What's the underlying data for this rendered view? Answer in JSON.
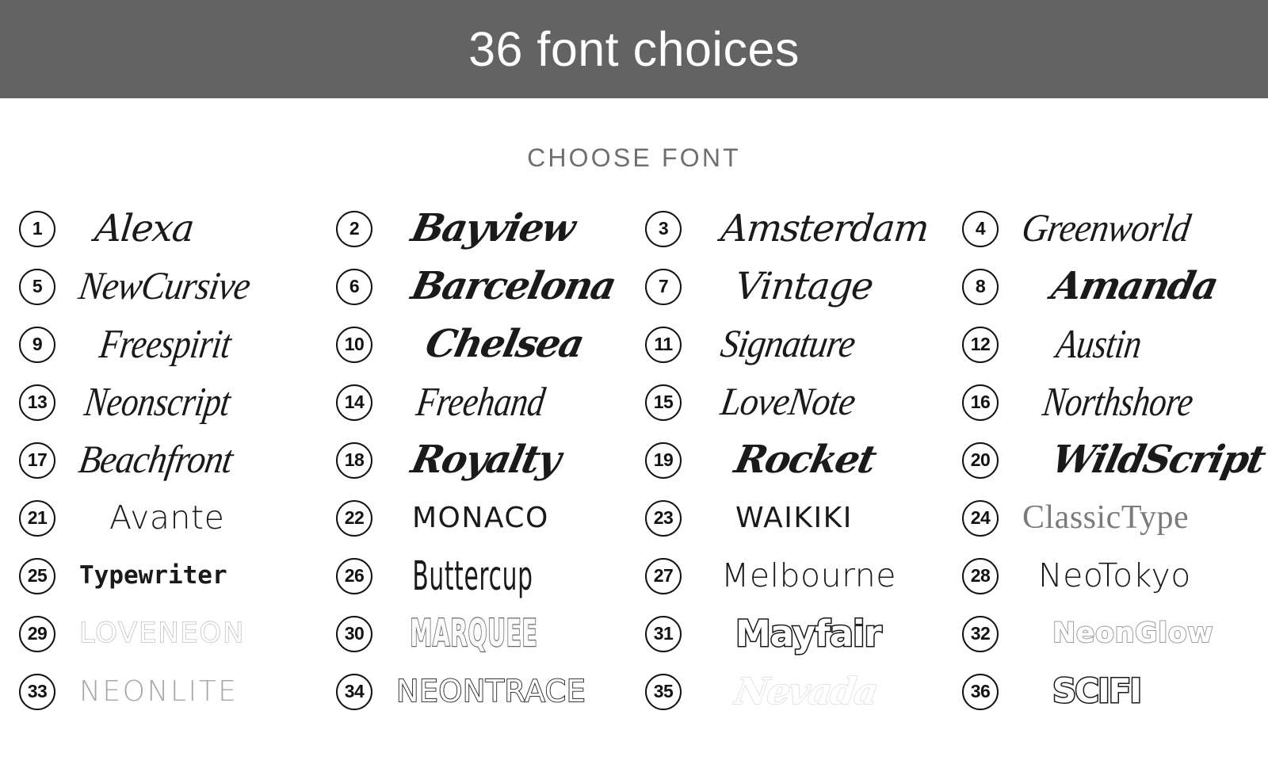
{
  "header": {
    "title": "36 font choices",
    "background_color": "#636363",
    "text_color": "#fdfdfd"
  },
  "section": {
    "label": "CHOOSE FONT",
    "text_color": "#6f6f6f"
  },
  "page": {
    "background_color": "#ffffff",
    "total_fonts": 36,
    "columns": 4,
    "rows": 9
  },
  "fonts": [
    {
      "number": "1",
      "name": "Alexa",
      "style": "s-script",
      "indent": "indent-2"
    },
    {
      "number": "2",
      "name": "Bayview",
      "style": "s-brush",
      "indent": "indent-2"
    },
    {
      "number": "3",
      "name": "Amsterdam",
      "style": "s-script",
      "indent": "indent-2"
    },
    {
      "number": "4",
      "name": "Greenworld",
      "style": "s-thin",
      "indent": "indent-1"
    },
    {
      "number": "5",
      "name": "NewCursive",
      "style": "s-thin",
      "indent": "indent-1"
    },
    {
      "number": "6",
      "name": "Barcelona",
      "style": "s-brush",
      "indent": "indent-2"
    },
    {
      "number": "7",
      "name": "Vintage",
      "style": "s-script",
      "indent": "indent-3"
    },
    {
      "number": "8",
      "name": "Amanda",
      "style": "s-brush",
      "indent": "indent-3"
    },
    {
      "number": "9",
      "name": "Freespirit",
      "style": "s-tall",
      "indent": "indent-2"
    },
    {
      "number": "10",
      "name": "Chelsea",
      "style": "s-brush",
      "indent": "indent-3"
    },
    {
      "number": "11",
      "name": "Signature",
      "style": "s-thin",
      "indent": "indent-2"
    },
    {
      "number": "12",
      "name": "Austin",
      "style": "s-tall",
      "indent": "indent-3"
    },
    {
      "number": "13",
      "name": "Neonscript",
      "style": "s-tall",
      "indent": "indent-1"
    },
    {
      "number": "14",
      "name": "Freehand",
      "style": "s-tall",
      "indent": "indent-2"
    },
    {
      "number": "15",
      "name": "LoveNote",
      "style": "s-thin",
      "indent": "indent-2"
    },
    {
      "number": "16",
      "name": "Northshore",
      "style": "s-tall",
      "indent": "indent-2"
    },
    {
      "number": "17",
      "name": "Beachfront",
      "style": "s-thin",
      "indent": "indent-1"
    },
    {
      "number": "18",
      "name": "Royalty",
      "style": "s-brush",
      "indent": "indent-2"
    },
    {
      "number": "19",
      "name": "Rocket",
      "style": "s-brush",
      "indent": "indent-3"
    },
    {
      "number": "20",
      "name": "WildScript",
      "style": "s-brush",
      "indent": "indent-3"
    },
    {
      "number": "21",
      "name": "Avante",
      "style": "s-geo",
      "indent": "indent-3"
    },
    {
      "number": "22",
      "name": "MONACO",
      "style": "s-geocaps",
      "indent": "indent-2"
    },
    {
      "number": "23",
      "name": "WAIKIKI",
      "style": "s-geocaps",
      "indent": "indent-3"
    },
    {
      "number": "24",
      "name": "ClassicType",
      "style": "s-serif",
      "indent": "indent-1"
    },
    {
      "number": "25",
      "name": "Typewriter",
      "style": "s-mono",
      "indent": "indent-1"
    },
    {
      "number": "26",
      "name": "Buttercup",
      "style": "s-cond",
      "indent": "indent-3"
    },
    {
      "number": "27",
      "name": "Melbourne",
      "style": "s-geo",
      "indent": "indent-2"
    },
    {
      "number": "28",
      "name": "NeoTokyo",
      "style": "s-geo",
      "indent": "indent-2"
    },
    {
      "number": "29",
      "name": "LOVENEON",
      "style": "s-neonoutline",
      "indent": "indent-1"
    },
    {
      "number": "30",
      "name": "MARQUEE",
      "style": "s-marquee",
      "indent": "indent-3"
    },
    {
      "number": "31",
      "name": "Mayfair",
      "style": "s-mayfair",
      "indent": "indent-3"
    },
    {
      "number": "32",
      "name": "NeonGlow",
      "style": "s-neonglow",
      "indent": "indent-3"
    },
    {
      "number": "33",
      "name": "NEONLITE",
      "style": "s-neonlite",
      "indent": "indent-1"
    },
    {
      "number": "34",
      "name": "NEONTRACE",
      "style": "s-neontrace",
      "indent": "indent-1"
    },
    {
      "number": "35",
      "name": "Nevada",
      "style": "s-nevada",
      "indent": "indent-3"
    },
    {
      "number": "36",
      "name": "SCIFI",
      "style": "s-scifi",
      "indent": "indent-3"
    }
  ]
}
